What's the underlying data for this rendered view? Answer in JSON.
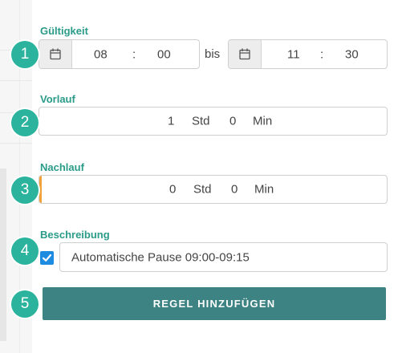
{
  "validity": {
    "label": "Gültigkeit",
    "from": {
      "hour": "08",
      "sep": ":",
      "minute": "00",
      "icon": "calendar-icon"
    },
    "connector": "bis",
    "to": {
      "hour": "11",
      "sep": ":",
      "minute": "30",
      "icon": "calendar-icon"
    }
  },
  "lead": {
    "label": "Vorlauf",
    "hours": "1",
    "hours_unit": "Std",
    "minutes": "0",
    "minutes_unit": "Min"
  },
  "lag": {
    "label": "Nachlauf",
    "hours": "0",
    "hours_unit": "Std",
    "minutes": "0",
    "minutes_unit": "Min",
    "accent_color": "#f3a23a"
  },
  "description": {
    "label": "Beschreibung",
    "checked": true,
    "value": "Automatische Pause 09:00-09:15"
  },
  "submit": {
    "label": "REGEL HINZUFÜGEN"
  },
  "steps": [
    "1",
    "2",
    "3",
    "4",
    "5"
  ],
  "colors": {
    "accent": "#2a9b89",
    "step_badge": "#2bb39d",
    "button": "#3d8384",
    "checkbox": "#1d8be0"
  }
}
